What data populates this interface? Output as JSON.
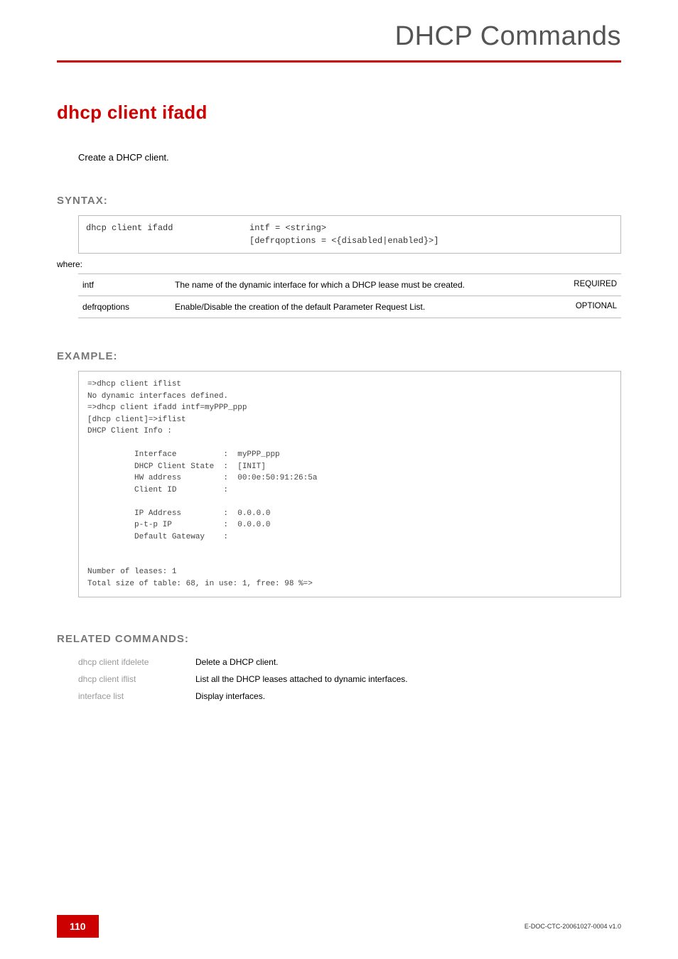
{
  "header": {
    "title": "DHCP Commands"
  },
  "command": {
    "title": "dhcp client ifadd",
    "description": "Create a DHCP client."
  },
  "syntax": {
    "label": "SYNTAX:",
    "command": "dhcp client ifadd",
    "args": "intf = <string>\n[defrqoptions = <{disabled|enabled}>]",
    "where": "where:",
    "params": [
      {
        "name": "intf",
        "desc": "The name of the dynamic interface for which a DHCP lease must be created.",
        "req": "REQUIRED"
      },
      {
        "name": "defrqoptions",
        "desc": "Enable/Disable the creation of the default Parameter Request List.",
        "req": "OPTIONAL"
      }
    ]
  },
  "example": {
    "label": "EXAMPLE:",
    "text": "=>dhcp client iflist\nNo dynamic interfaces defined.\n=>dhcp client ifadd intf=myPPP_ppp\n[dhcp client]=>iflist\nDHCP Client Info :\n\n          Interface          :  myPPP_ppp\n          DHCP Client State  :  [INIT]\n          HW address         :  00:0e:50:91:26:5a\n          Client ID          :\n\n          IP Address         :  0.0.0.0\n          p-t-p IP           :  0.0.0.0\n          Default Gateway    :\n\n\nNumber of leases: 1\nTotal size of table: 68, in use: 1, free: 98 %=>"
  },
  "related": {
    "label": "RELATED COMMANDS:",
    "items": [
      {
        "cmd": "dhcp client ifdelete",
        "desc": "Delete a DHCP client."
      },
      {
        "cmd": "dhcp client iflist",
        "desc": "List all the DHCP leases attached to dynamic interfaces."
      },
      {
        "cmd": "interface list",
        "desc": "Display interfaces."
      }
    ]
  },
  "footer": {
    "page": "110",
    "docid": "E-DOC-CTC-20061027-0004 v1.0"
  }
}
